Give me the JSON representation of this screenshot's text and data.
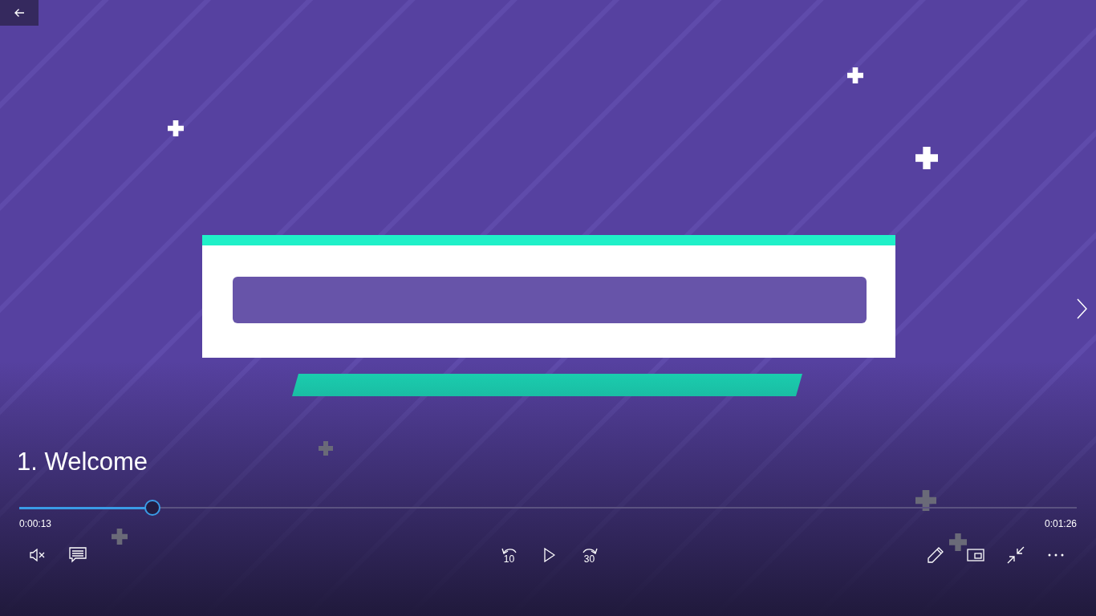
{
  "lecture_title": "1. Welcome",
  "progress": {
    "level": 0.126,
    "elapsed": "0:00:13",
    "duration": "0:01:26"
  },
  "controls": {
    "left": [
      {
        "kind": "mute"
      },
      {
        "kind": "captions"
      }
    ],
    "center": [
      {
        "kind": "rewind",
        "label": "10"
      },
      {
        "kind": "play"
      },
      {
        "kind": "forward",
        "label": "30"
      }
    ],
    "right": [
      {
        "kind": "note"
      },
      {
        "kind": "miniplayer"
      },
      {
        "kind": "exit_fullscreen"
      },
      {
        "kind": "more"
      }
    ]
  }
}
